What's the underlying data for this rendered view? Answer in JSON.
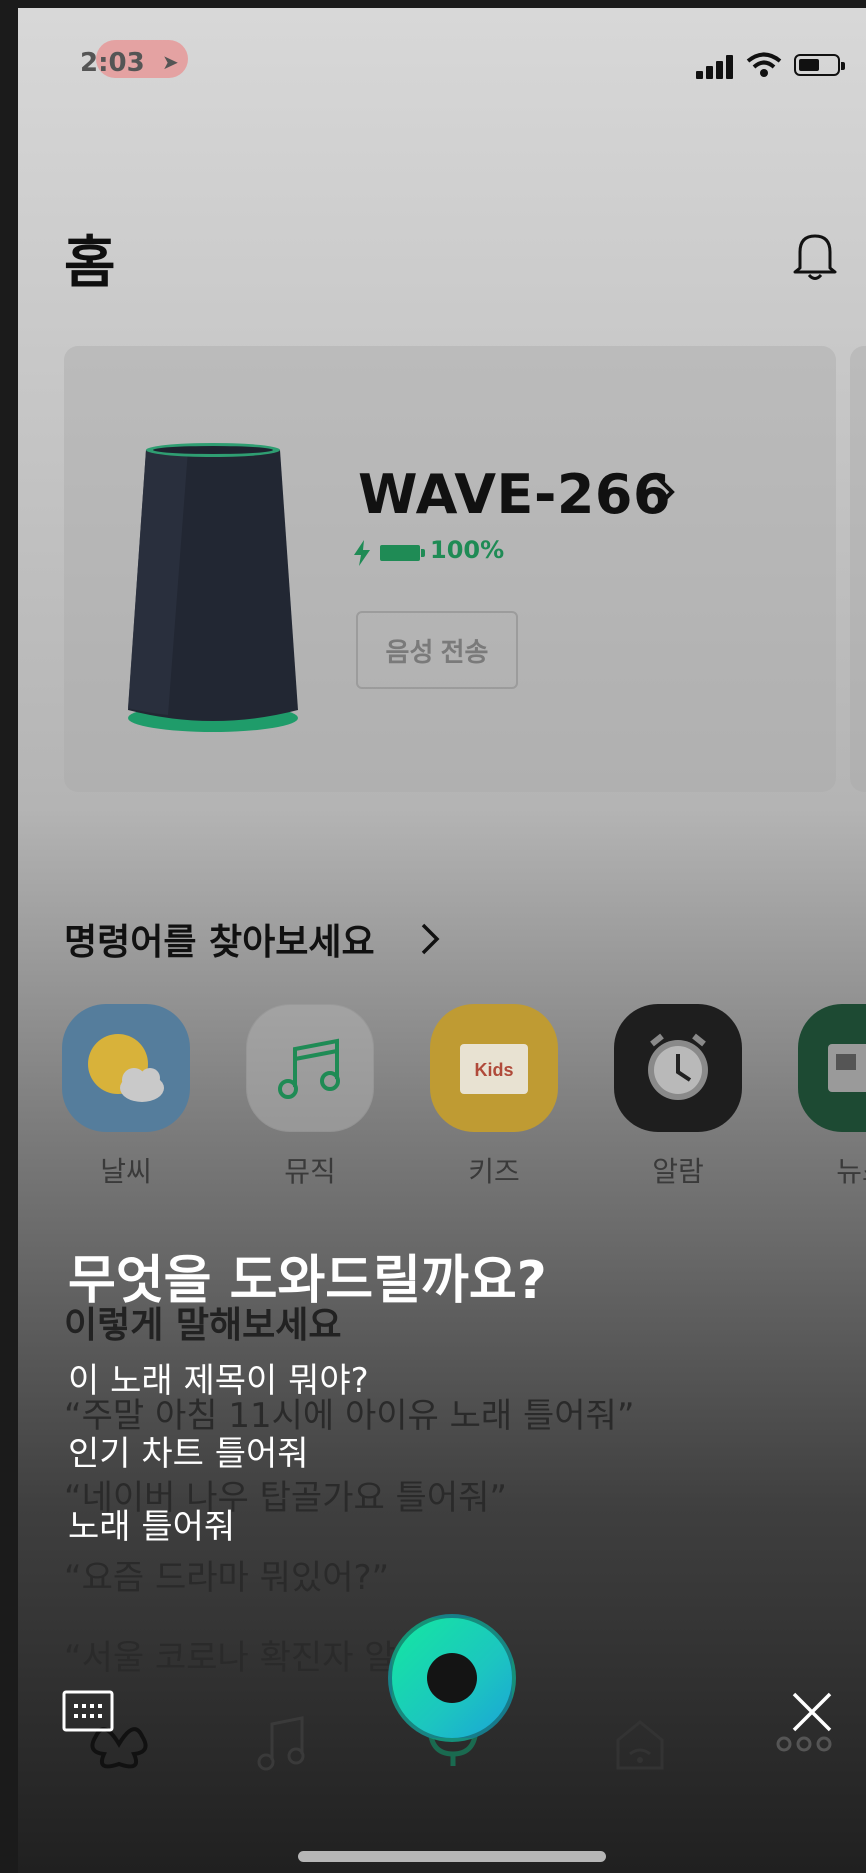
{
  "status_bar": {
    "time": "2:03"
  },
  "header": {
    "title": "홈"
  },
  "device": {
    "name": "WAVE-266",
    "battery": "100%",
    "voice_button": "음성 전송"
  },
  "commands": {
    "title": "명령어를 찾아보세요",
    "categories": [
      {
        "label": "날씨",
        "icon": "weather-icon"
      },
      {
        "label": "뮤직",
        "icon": "music-note-icon"
      },
      {
        "label": "키즈",
        "icon": "kids-book-icon",
        "badge": "Kids"
      },
      {
        "label": "알람",
        "icon": "alarm-clock-icon"
      },
      {
        "label": "뉴스",
        "icon": "news-icon"
      }
    ]
  },
  "examples": {
    "title": "이렇게 말해보세요",
    "items": [
      "“주말 아침 11시에 아이유 노래 틀어줘”",
      "“네이버 나우 탑골가요 틀어줘”",
      "“요즘 드라마 뭐있어?”",
      "“서울 코로나 확진자 알려줘”"
    ]
  },
  "assistant": {
    "prompt": "무엇을 도와드릴까요?",
    "suggestions": [
      "이 노래 제목이 뭐야?",
      "인기 차트 틀어줘",
      "노래 틀어줘"
    ]
  },
  "colors": {
    "accent": "#1f8b55",
    "mic_gradient_start": "#14e8a0",
    "mic_gradient_end": "#1aa3d8"
  }
}
